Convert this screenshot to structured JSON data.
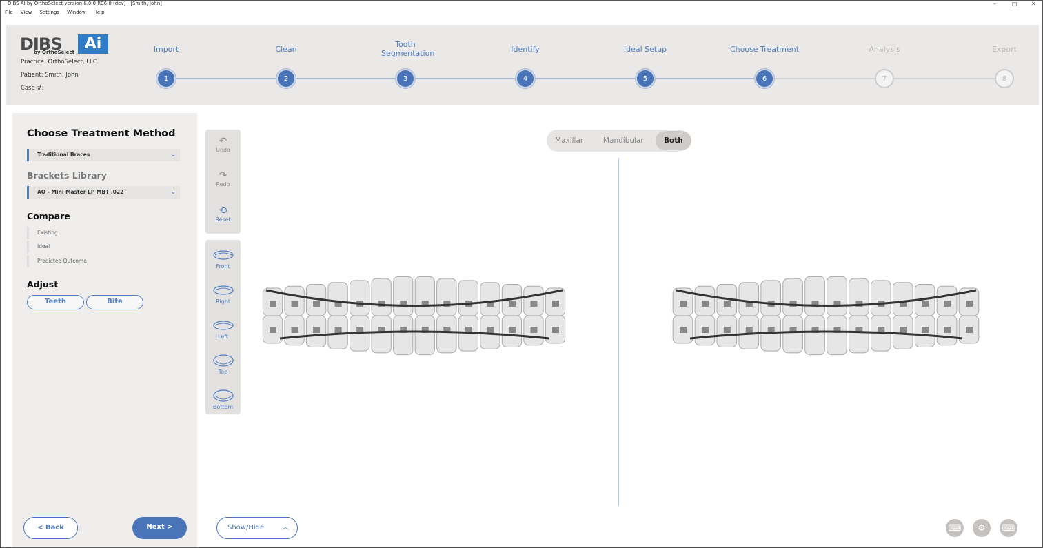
{
  "window": {
    "title": "DIBS AI by OrthoSelect version 6.0.0 RC6.0 (dev) - [Smith, John]",
    "controls": [
      "–",
      "▢",
      "✕"
    ]
  },
  "menu": [
    "File",
    "View",
    "Settings",
    "Window",
    "Help"
  ],
  "header": {
    "logo_text": "DIBS AI",
    "logo_sub": "by OrthoSelect",
    "practice": "Practice: OrthoSelect, LLC",
    "patient": "Patient: Smith, John",
    "case": "Case #:"
  },
  "steps": [
    {
      "n": "1",
      "label": "Import",
      "done": true
    },
    {
      "n": "2",
      "label": "Clean",
      "done": true
    },
    {
      "n": "3",
      "label": "Tooth Segmentation",
      "done": true
    },
    {
      "n": "4",
      "label": "Identify",
      "done": true
    },
    {
      "n": "5",
      "label": "Ideal Setup",
      "done": true
    },
    {
      "n": "6",
      "label": "Choose Treatment",
      "done": true
    },
    {
      "n": "7",
      "label": "Analysis",
      "done": false
    },
    {
      "n": "8",
      "label": "Export",
      "done": false
    }
  ],
  "sidebar": {
    "title": "Choose Treatment Method",
    "method": "Traditional Braces",
    "brackets_title": "Brackets Library",
    "brackets": "AO - Mini Master LP MBT .022",
    "compare_title": "Compare",
    "compare": [
      "Existing",
      "Ideal",
      "Predicted Outcome"
    ],
    "adjust_title": "Adjust",
    "adjust": [
      "Teeth",
      "Bite"
    ],
    "back": "<  Back",
    "next": "Next  >"
  },
  "toolbar": {
    "history": [
      {
        "icon": "undo-icon",
        "glyph": "↶",
        "label": "Undo"
      },
      {
        "icon": "redo-icon",
        "glyph": "↷",
        "label": "Redo"
      },
      {
        "icon": "reset-icon",
        "glyph": "⟲",
        "label": "Reset"
      }
    ],
    "views": [
      {
        "label": "Front"
      },
      {
        "label": "Right"
      },
      {
        "label": "Left"
      },
      {
        "label": "Top"
      },
      {
        "label": "Bottom"
      }
    ]
  },
  "arch_toggle": {
    "options": [
      "Maxillar",
      "Mandibular",
      "Both"
    ],
    "selected": "Both"
  },
  "show_hide": "Show/Hide",
  "colors": {
    "accent": "#4a74b8",
    "panel": "#efeeed",
    "header": "#ebe9e7"
  }
}
